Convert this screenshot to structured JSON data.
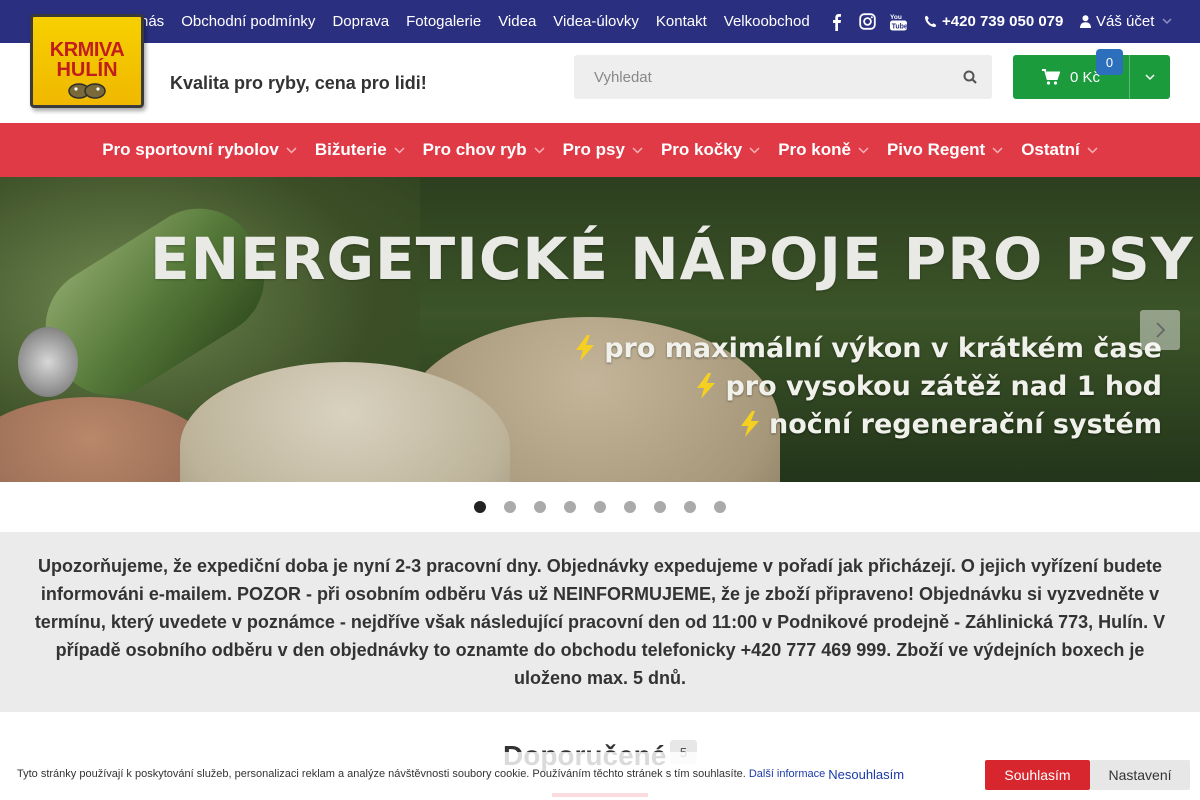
{
  "top_nav": {
    "items": [
      {
        "label": "nás"
      },
      {
        "label": "Obchodní podmínky"
      },
      {
        "label": "Doprava"
      },
      {
        "label": "Fotogalerie"
      },
      {
        "label": "Videa"
      },
      {
        "label": "Videa-úlovky"
      },
      {
        "label": "Kontakt"
      },
      {
        "label": "Velkoobchod"
      }
    ],
    "socials": [
      "facebook-icon",
      "instagram-icon",
      "youtube-icon"
    ],
    "phone": "+420 739 050 079",
    "account": "Váš účet"
  },
  "header": {
    "logo_line1": "KRMIVA",
    "logo_line2": "HULÍN",
    "tagline": "Kvalita pro ryby, cena pro lidi!",
    "search_placeholder": "Vyhledat",
    "cart_total": "0 Kč",
    "cart_count": "0"
  },
  "main_nav": {
    "items": [
      {
        "label": "Pro sportovní rybolov"
      },
      {
        "label": "Bižuterie"
      },
      {
        "label": "Pro chov ryb"
      },
      {
        "label": "Pro psy"
      },
      {
        "label": "Pro kočky"
      },
      {
        "label": "Pro koně"
      },
      {
        "label": "Pivo Regent"
      },
      {
        "label": "Ostatní"
      }
    ]
  },
  "banner": {
    "title": "ENERGETICKÉ NÁPOJE PRO PSY",
    "points": [
      "pro maximální výkon v krátkém čase",
      "pro vysokou zátěž nad 1 hod",
      "noční regenerační systém"
    ],
    "slide_count": 9,
    "active_slide": 1
  },
  "notice": {
    "text": "Upozorňujeme, že expediční doba je nyní 2-3 pracovní dny. Objednávky expedujeme v pořadí jak přicházejí. O jejich vyřízení budete informováni e-mailem. POZOR - při osobním odběru Vás už NEINFORMUJEME, že je zboží připraveno! Objednávku si vyzvedněte v termínu, který uvedete v poznámce - nejdříve však následující pracovní den od 11:00 v Podnikové prodejně - Záhlinická 773, Hulín. V případě osobního odběru v den objednávky to oznamte do obchodu telefonicky +420 777 469 999. Zboží ve výdejních boxech je uloženo max. 5 dnů."
  },
  "recommended": {
    "title": "Doporučené",
    "count": "5"
  },
  "cookie": {
    "text": "Tyto stránky používají k poskytování služeb, personalizaci reklam a analýze návštěvnosti soubory cookie. Používáním těchto stránek s tím souhlasíte.",
    "more_info": "Další informace",
    "deny": "Nesouhlasím",
    "accept": "Souhlasím",
    "settings": "Nastavení"
  },
  "colors": {
    "topbar": "#2b2f80",
    "main_nav": "#e03a47",
    "cart": "#1b9b3c",
    "cart_badge": "#2b6fbd",
    "accept_button": "#d7262d"
  }
}
